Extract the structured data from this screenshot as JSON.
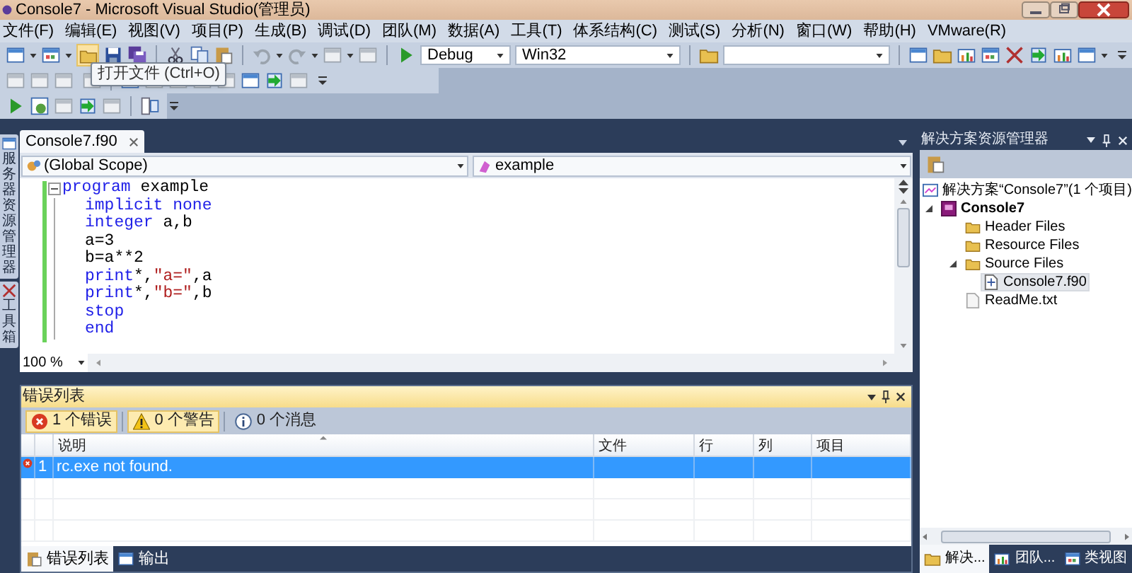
{
  "window": {
    "title": "Console7 - Microsoft Visual Studio(管理员)"
  },
  "menu": [
    "文件(F)",
    "编辑(E)",
    "视图(V)",
    "项目(P)",
    "生成(B)",
    "调试(D)",
    "团队(M)",
    "数据(A)",
    "工具(T)",
    "体系结构(C)",
    "测试(S)",
    "分析(N)",
    "窗口(W)",
    "帮助(H)",
    "VMware(R)"
  ],
  "toolbar": {
    "configuration": "Debug",
    "platform": "Win32"
  },
  "tooltip": "打开文件 (Ctrl+O)",
  "side_tabs": [
    "服务器资源管理器",
    "工具箱"
  ],
  "editor": {
    "tabs": [
      {
        "label": "Console7.f90",
        "selected": true
      }
    ],
    "scope": "(Global Scope)",
    "member": "example",
    "zoom": "100 %",
    "lines": [
      {
        "segments": [
          {
            "kind": "keyword",
            "text": "program"
          },
          {
            "kind": "plain",
            "text": " example"
          }
        ],
        "children": [
          {
            "segments": [
              {
                "kind": "keyword",
                "text": "implicit none"
              }
            ]
          },
          {
            "segments": [
              {
                "kind": "keyword",
                "text": "integer"
              },
              {
                "kind": "plain",
                "text": " a,b"
              }
            ]
          },
          {
            "segments": [
              {
                "kind": "plain",
                "text": "a=3"
              }
            ]
          },
          {
            "segments": [
              {
                "kind": "plain",
                "text": "b=a**2"
              }
            ]
          },
          {
            "segments": [
              {
                "kind": "keyword",
                "text": "print"
              },
              {
                "kind": "plain",
                "text": "*,"
              },
              {
                "kind": "string",
                "text": "\"a=\""
              },
              {
                "kind": "plain",
                "text": ",a"
              }
            ]
          },
          {
            "segments": [
              {
                "kind": "keyword",
                "text": "print"
              },
              {
                "kind": "plain",
                "text": "*,"
              },
              {
                "kind": "string",
                "text": "\"b=\""
              },
              {
                "kind": "plain",
                "text": ",b"
              }
            ]
          },
          {
            "segments": [
              {
                "kind": "keyword",
                "text": "stop"
              }
            ]
          },
          {
            "segments": [
              {
                "kind": "keyword",
                "text": "end"
              }
            ]
          }
        ]
      }
    ]
  },
  "error_list": {
    "title": "错误列表",
    "filters": [
      {
        "kind": "error",
        "label": "1 个错误",
        "selected": true
      },
      {
        "kind": "warning",
        "label": "0 个警告",
        "selected": true
      },
      {
        "kind": "message",
        "label": "0 个消息",
        "selected": false
      }
    ],
    "columns": [
      "说明",
      "文件",
      "行",
      "列",
      "项目"
    ],
    "rows": [
      {
        "kind": "error",
        "number": "1",
        "description": "rc.exe not found.",
        "selected": true
      }
    ]
  },
  "bottom_tabs": [
    {
      "kind": "errors",
      "label": "错误列表",
      "selected": true
    },
    {
      "kind": "output",
      "label": "输出",
      "selected": false
    }
  ],
  "solution_explorer": {
    "title": "解决方案资源管理器",
    "tree": [
      {
        "kind": "solution",
        "label": "解决方案“Console7”(1 个项目)",
        "selected": false,
        "children": [
          {
            "kind": "project",
            "label": "Console7",
            "selected": false,
            "expanded": true,
            "children": [
              {
                "kind": "folder",
                "label": "Header Files",
                "selected": false
              },
              {
                "kind": "folder",
                "label": "Resource Files",
                "selected": false
              },
              {
                "kind": "folder",
                "label": "Source Files",
                "selected": false,
                "expanded": true,
                "children": [
                  {
                    "kind": "code_file",
                    "label": "Console7.f90",
                    "selected": true
                  }
                ]
              },
              {
                "kind": "text_file",
                "label": "ReadMe.txt",
                "selected": false
              }
            ]
          }
        ]
      }
    ],
    "tabs": [
      {
        "kind": "solution",
        "label": "解决...",
        "selected": true
      },
      {
        "kind": "team",
        "label": "团队...",
        "selected": false
      },
      {
        "kind": "classes",
        "label": "类视图",
        "selected": false
      }
    ]
  }
}
